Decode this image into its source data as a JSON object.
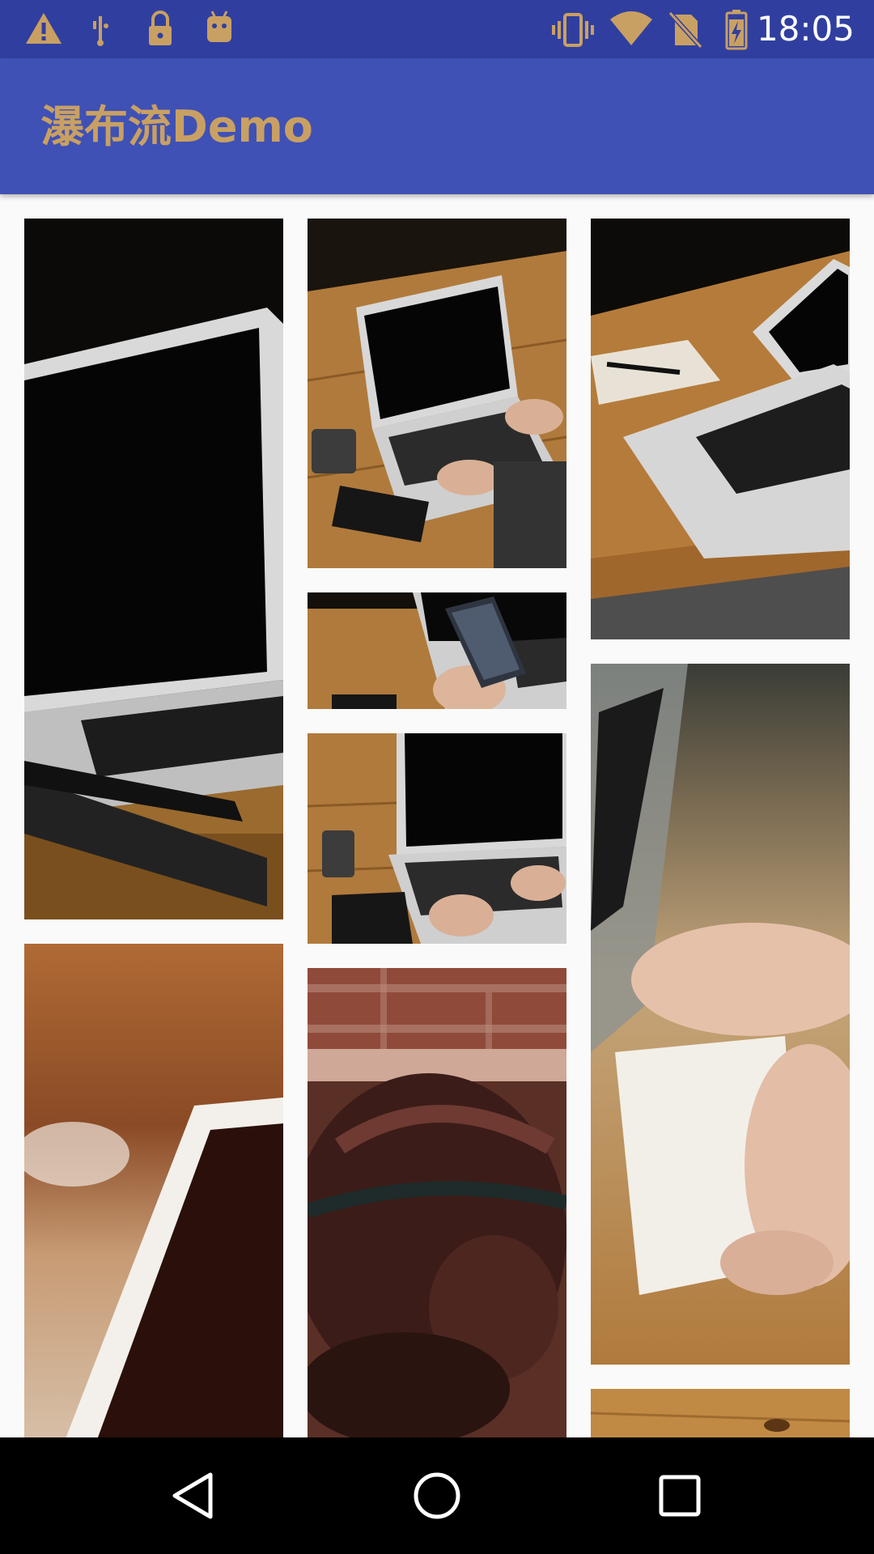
{
  "status_bar": {
    "time": "18:05",
    "left_icons": [
      "warning-icon",
      "usb-icon",
      "lock-icon",
      "android-debug-icon"
    ],
    "right_icons": [
      "vibrate-icon",
      "wifi-icon",
      "no-sim-icon",
      "battery-charging-icon"
    ],
    "background": "#303f9f"
  },
  "app_bar": {
    "title": "瀑布流Demo",
    "background": "#3f51b5",
    "title_color": "#c9a063"
  },
  "feed": {
    "layout": "staggered-grid",
    "columns": 3,
    "items": [
      {
        "column": 1,
        "subject": "laptop-closeup-screen"
      },
      {
        "column": 1,
        "subject": "tablet-blurred"
      },
      {
        "column": 2,
        "subject": "hands-typing-on-laptop"
      },
      {
        "column": 2,
        "subject": "hand-holding-phone"
      },
      {
        "column": 2,
        "subject": "hands-typing-on-laptop-with-phone"
      },
      {
        "column": 2,
        "subject": "leather-bag"
      },
      {
        "column": 3,
        "subject": "laptop-on-table-with-notebook"
      },
      {
        "column": 3,
        "subject": "hands-on-notebook-blurred"
      },
      {
        "column": 3,
        "subject": "wooden-table"
      }
    ]
  },
  "nav_bar": {
    "buttons": [
      "back",
      "home",
      "recents"
    ]
  }
}
